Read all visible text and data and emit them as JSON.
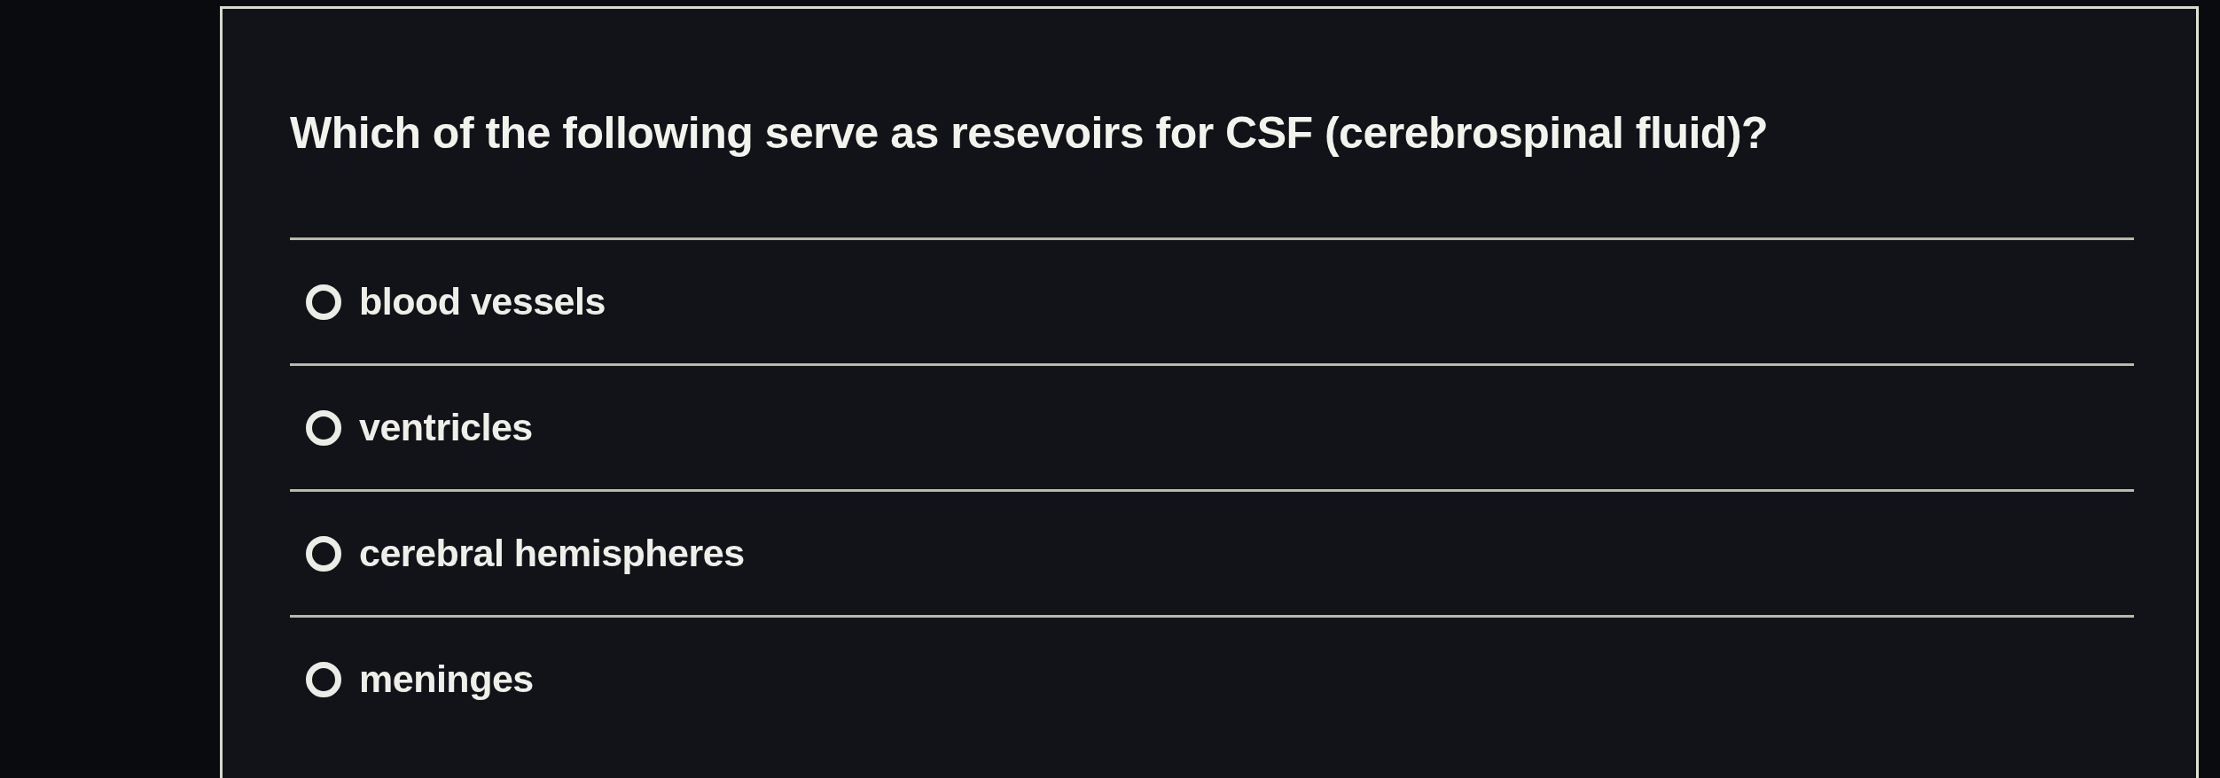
{
  "question": {
    "text": "Which of the following serve as resevoirs for CSF (cerebrospinal fluid)?"
  },
  "options": [
    {
      "label": "blood vessels",
      "selected": false
    },
    {
      "label": "ventricles",
      "selected": false
    },
    {
      "label": "cerebral hemispheres",
      "selected": false
    },
    {
      "label": "meninges",
      "selected": false
    }
  ]
}
